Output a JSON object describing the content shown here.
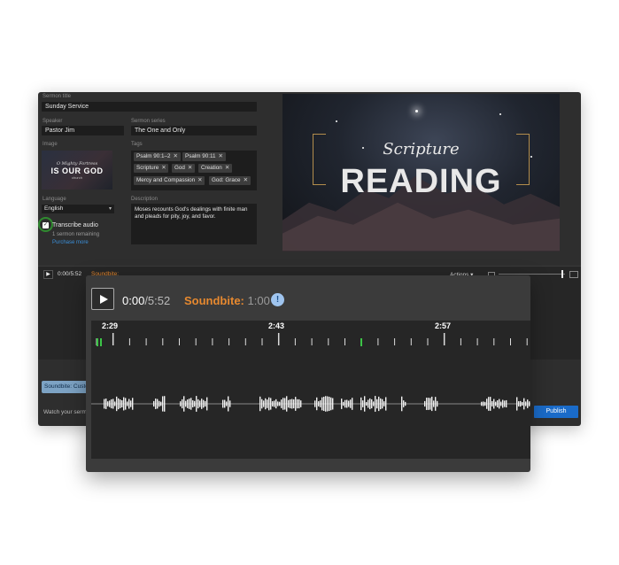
{
  "form": {
    "sermon_title_label": "Sermon title",
    "sermon_title_value": "Sunday Service",
    "speaker_label": "Speaker",
    "speaker_value": "Pastor Jim",
    "sermon_series_label": "Sermon series",
    "sermon_series_value": "The One and Only",
    "image_label": "Image",
    "image_text_1": "O Mighty Fortress",
    "image_text_2": "IS OUR GOD",
    "image_text_3": "church",
    "tags_label": "Tags",
    "tags": [
      "Psalm 90:1–2",
      "Psalm 90:11",
      "Scripture",
      "God",
      "Creation",
      "Mercy and Compassion",
      "God: Grace"
    ],
    "language_label": "Language",
    "language_value": "English",
    "description_label": "Description",
    "description_value": "Moses recounts God's dealings with finite man and pleads for pity, joy, and favor.",
    "transcribe_label": "Transcribe audio",
    "sermons_remaining": "1 sermon remaining",
    "purchase_more": "Purchase more"
  },
  "hero": {
    "line1": "Scripture",
    "line2": "READING"
  },
  "toolbar": {
    "time": "0:00/5:52",
    "soundbite_label": "Soundbite:",
    "soundbite_value": "1:00",
    "actions_label": "Actions ▾"
  },
  "footer": {
    "soundbite_tab": "Soundbite: Custom",
    "watch_text": "Watch your sermon",
    "publish_label": "Publish"
  },
  "overlay": {
    "current_time": "0:00",
    "duration": "/5:52",
    "soundbite_label": "Soundbite:",
    "soundbite_value": "1:00",
    "info_glyph": "!",
    "timeline_marks": [
      "2:29",
      "2:43",
      "2:57"
    ]
  },
  "colors": {
    "accent_orange": "#e7892f",
    "publish_blue": "#1a6bc9",
    "selection_green": "#3cc447",
    "checkbox_ring": "#2f8a2f"
  }
}
